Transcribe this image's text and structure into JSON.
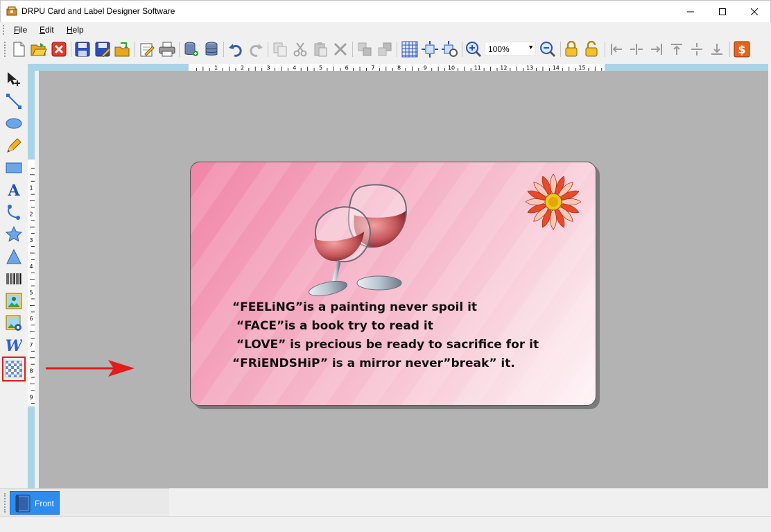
{
  "window": {
    "title": "DRPU Card and Label Designer Software"
  },
  "menu": {
    "items": [
      {
        "label": "File",
        "accelerator": "F"
      },
      {
        "label": "Edit",
        "accelerator": "E"
      },
      {
        "label": "Help",
        "accelerator": "H"
      }
    ]
  },
  "toolbar": {
    "zoom_value": "100%",
    "icons": [
      "new-file-icon",
      "open-folder-icon",
      "close-red-icon",
      "save-icon",
      "save-as-icon",
      "export-icon",
      "properties-icon",
      "print-icon",
      "database-add-icon",
      "database-icon",
      "undo-icon",
      "redo-icon",
      "copy-icon",
      "cut-icon",
      "paste-icon",
      "delete-icon",
      "bring-front-icon",
      "send-back-icon",
      "grid-icon",
      "center-icon",
      "fit-icon",
      "zoom-in-icon",
      "zoom-out-icon",
      "lock-icon",
      "unlock-icon",
      "align-left-icon",
      "align-center-icon",
      "align-right-icon",
      "align-top-icon",
      "align-middle-icon",
      "align-bottom-icon",
      "price-icon"
    ]
  },
  "toolbox": {
    "tools": [
      "pointer-icon",
      "line-icon",
      "ellipse-icon",
      "pencil-icon",
      "rectangle-icon",
      "text-icon",
      "arc-icon",
      "star-icon",
      "triangle-icon",
      "barcode-icon",
      "picture-icon",
      "library-icon",
      "wordart-icon",
      "watermark-icon"
    ],
    "selected": "watermark-icon"
  },
  "ruler": {
    "horizontal_labels": [
      "1",
      "2",
      "3",
      "4",
      "5",
      "6",
      "7",
      "8",
      "9",
      "10",
      "11",
      "12",
      "13",
      "14",
      "15"
    ],
    "vertical_labels": [
      "1",
      "2",
      "3",
      "4",
      "5",
      "6",
      "7",
      "8",
      "9"
    ]
  },
  "card": {
    "lines": [
      "“FEELiNG”is a painting never spoil it",
      " “FACE”is a book try to read it",
      " “LOVE” is precious be ready to sacrifice for it",
      "“FRiENDSHiP” is a mirror never”break” it."
    ],
    "text_color": "#111111"
  },
  "tabs": {
    "items": [
      {
        "label": "Front",
        "active": true
      }
    ]
  },
  "colors": {
    "accent_tab": "#2e8cf0",
    "highlight_border": "#e21b1b",
    "arrow": "#e21b1b",
    "ruler_band": "#a9d3e6",
    "canvas": "#b3b3b3"
  }
}
